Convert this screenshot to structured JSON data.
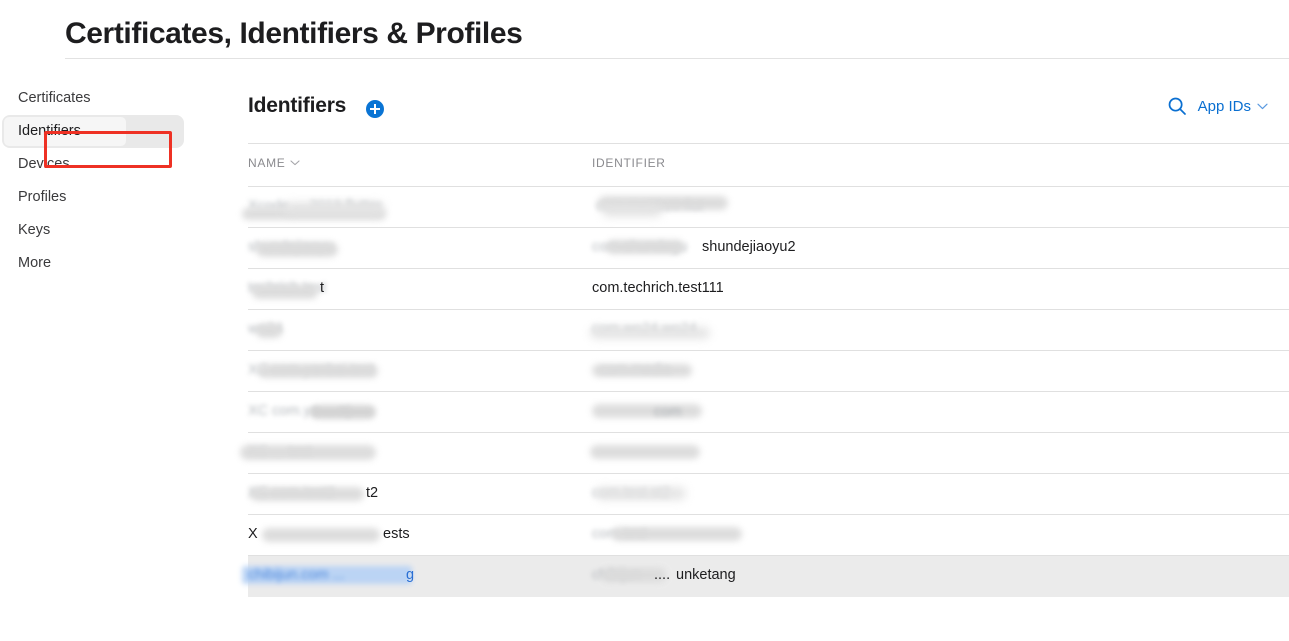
{
  "header": {
    "title": "Certificates, Identifiers & Profiles"
  },
  "sidebar": {
    "items": [
      {
        "label": "Certificates",
        "selected": false
      },
      {
        "label": "Identifiers",
        "selected": true
      },
      {
        "label": "Devices",
        "selected": false
      },
      {
        "label": "Profiles",
        "selected": false
      },
      {
        "label": "Keys",
        "selected": false
      },
      {
        "label": "More",
        "selected": false
      }
    ]
  },
  "main": {
    "section_title": "Identifiers",
    "add_button_label": "+",
    "search_icon": "search-icon",
    "filter": {
      "value": "App IDs",
      "chevron": "chevron-down-icon"
    },
    "table": {
      "columns": [
        {
          "label": "NAME",
          "sortable": true,
          "sort_icon": "chevron-down-icon"
        },
        {
          "label": "IDENTIFIER",
          "sortable": false
        }
      ],
      "rows": [
        {
          "name": "",
          "identifier": "",
          "redacted": true,
          "highlighted": false
        },
        {
          "name": "",
          "identifier": "shundejiaoyu2",
          "redacted": true,
          "highlighted": false
        },
        {
          "name": "",
          "identifier": "com.techrich.test111",
          "redacted": true,
          "highlighted": false
        },
        {
          "name": "",
          "identifier": "",
          "redacted": true,
          "highlighted": false
        },
        {
          "name": "",
          "identifier": "",
          "redacted": true,
          "highlighted": false
        },
        {
          "name": "",
          "identifier": "",
          "redacted": true,
          "highlighted": false
        },
        {
          "name": "",
          "identifier": "",
          "redacted": true,
          "highlighted": false
        },
        {
          "name": "",
          "identifier": "",
          "redacted": true,
          "highlighted": false
        },
        {
          "name": "",
          "identifier": "",
          "redacted": true,
          "highlighted": false
        },
        {
          "name": "",
          "identifier": "unketang",
          "redacted": true,
          "highlighted": true
        }
      ]
    }
  },
  "annotation": {
    "type": "highlight-box",
    "target": "Identifiers",
    "color": "#ee3124"
  },
  "colors": {
    "accent_blue": "#0a74d4",
    "link_blue": "#0a6fd1",
    "annotation_red": "#ee3124",
    "row_highlight": "#ebebeb",
    "divider": "#e0e0e0",
    "text_primary": "#1d1d1f",
    "text_muted": "#8a8a8e"
  }
}
